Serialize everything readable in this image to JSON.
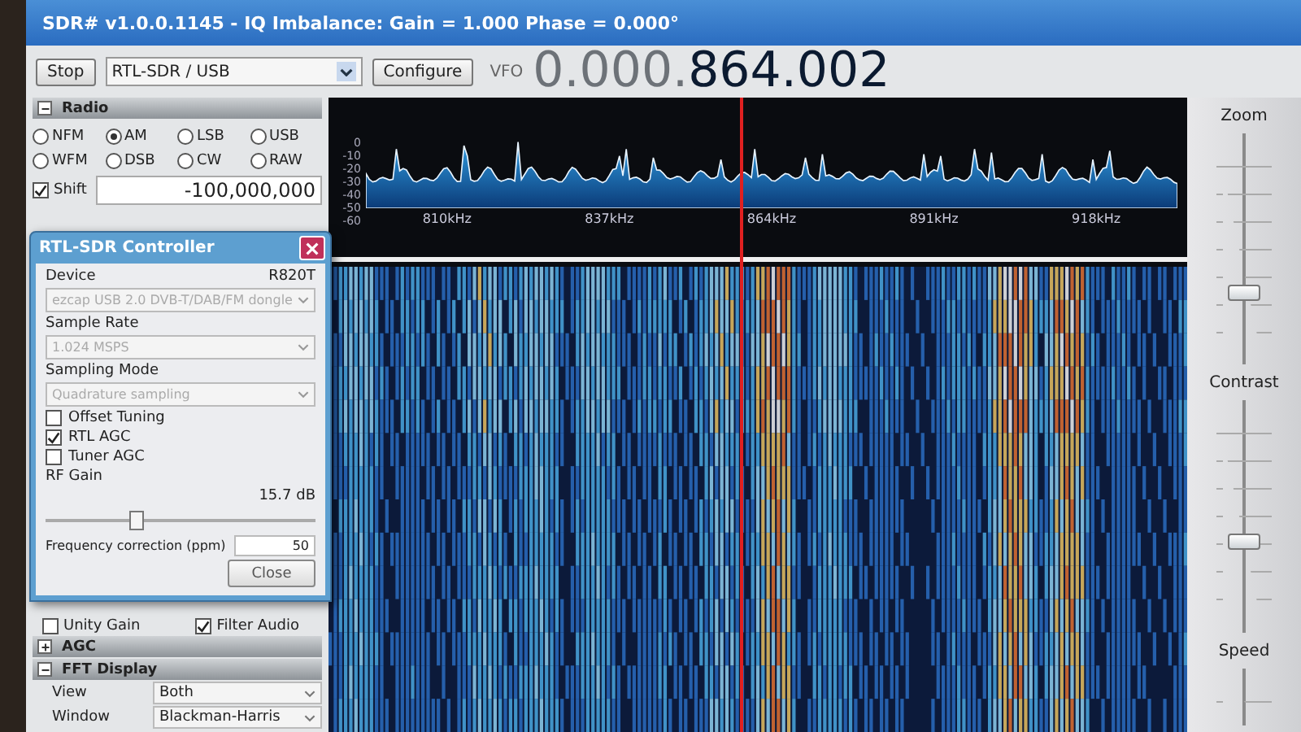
{
  "window": {
    "title": "SDR# v1.0.0.1145 - IQ Imbalance: Gain = 1.000 Phase = 0.000°"
  },
  "toolbar": {
    "stop_button": "Stop",
    "source": "RTL-SDR / USB",
    "configure_button": "Configure",
    "vfo_label": "VFO",
    "frequency_dim": "0.000.",
    "frequency": "864.002"
  },
  "radio_panel": {
    "title": "Radio",
    "expanded": true,
    "modes": [
      {
        "label": "NFM",
        "selected": false
      },
      {
        "label": "AM",
        "selected": true
      },
      {
        "label": "LSB",
        "selected": false
      },
      {
        "label": "USB",
        "selected": false
      },
      {
        "label": "WFM",
        "selected": false
      },
      {
        "label": "DSB",
        "selected": false
      },
      {
        "label": "CW",
        "selected": false
      },
      {
        "label": "RAW",
        "selected": false
      }
    ],
    "shift": {
      "label": "Shift",
      "checked": true,
      "value": "-100,000,000"
    }
  },
  "audio_options": [
    {
      "label": "Unity Gain",
      "checked": false
    },
    {
      "label": "Filter Audio",
      "checked": true
    }
  ],
  "sections": [
    {
      "title": "AGC",
      "expanded": false
    },
    {
      "title": "FFT Display",
      "expanded": true
    }
  ],
  "fft_display": [
    {
      "label": "View",
      "value": "Both"
    },
    {
      "label": "Window",
      "value": "Blackman-Harris"
    }
  ],
  "spectrum": {
    "y_labels": [
      "0",
      "-10",
      "-20",
      "-30",
      "-40",
      "-50",
      "-60"
    ],
    "x_labels": [
      "810kHz",
      "837kHz",
      "864kHz",
      "891kHz",
      "918kHz"
    ]
  },
  "side_sliders": [
    {
      "label": "Zoom",
      "level": 0.3
    },
    {
      "label": "Contrast",
      "level": 0.38
    },
    {
      "label": "Speed"
    }
  ],
  "controller": {
    "title": "RTL-SDR Controller",
    "tuner": "R820T",
    "selects": [
      {
        "label": "Device",
        "value": "ezcap USB 2.0 DVB-T/DAB/FM dongle",
        "disabled": true
      },
      {
        "label": "Sample Rate",
        "value": "1.024 MSPS",
        "disabled": true
      },
      {
        "label": "Sampling Mode",
        "value": "Quadrature sampling",
        "disabled": true
      }
    ],
    "options": [
      {
        "label": "Offset Tuning",
        "checked": false
      },
      {
        "label": "RTL AGC",
        "checked": true
      },
      {
        "label": "Tuner AGC",
        "checked": false
      }
    ],
    "rf_gain": {
      "label": "RF Gain",
      "reading": "15.7 dB",
      "level": 0.33
    },
    "freq_correction": {
      "label": "Frequency correction (ppm)",
      "value": "50"
    },
    "close_button": "Close"
  }
}
